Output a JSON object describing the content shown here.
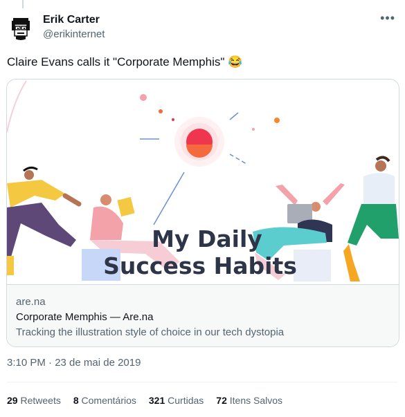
{
  "author": {
    "name": "Erik Carter",
    "handle": "@erikinternet"
  },
  "tweet": {
    "text": "Claire Evans calls it \"Corporate Memphis\"",
    "emoji": "😂"
  },
  "card": {
    "image_heading_line1": "My Daily",
    "image_heading_line2": "Success Habits",
    "domain": "are.na",
    "title": "Corporate Memphis — Are.na",
    "description": "Tracking the illustration style of choice in our tech dystopia"
  },
  "timestamp": "3:10 PM · 23 de mai de 2019",
  "stats": [
    {
      "count": "29",
      "label": "Retweets"
    },
    {
      "count": "8",
      "label": "Comentários"
    },
    {
      "count": "321",
      "label": "Curtidas"
    },
    {
      "count": "72",
      "label": "Itens Salvos"
    }
  ],
  "more_icon": "•••",
  "colors": {
    "text": "#0f1419",
    "secondary": "#536471",
    "border": "#cfd9de",
    "heading": "#2e3548",
    "sun": "#f0364e"
  }
}
